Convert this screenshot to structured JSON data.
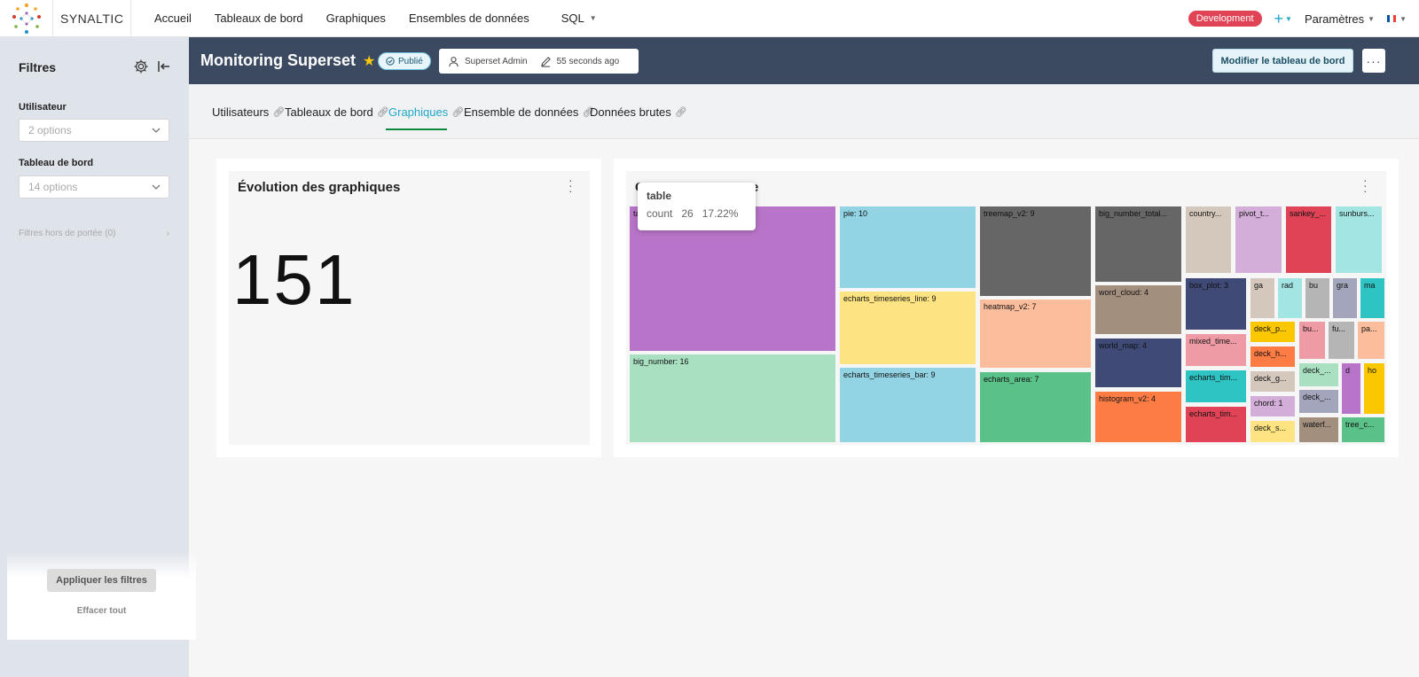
{
  "nav": {
    "brand": "SYNALTIC",
    "items": [
      "Accueil",
      "Tableaux de bord",
      "Graphiques",
      "Ensembles de données"
    ],
    "sql": "SQL",
    "env_badge": "Development",
    "plus": "+",
    "settings": "Paramètres"
  },
  "sidebar": {
    "title": "Filtres",
    "filters": [
      {
        "label": "Utilisateur",
        "placeholder": "2 options"
      },
      {
        "label": "Tableau de bord",
        "placeholder": "14 options"
      }
    ],
    "out_of_scope": "Filtres hors de portée (0)",
    "apply": "Appliquer les filtres",
    "clear": "Effacer tout"
  },
  "dashboard": {
    "title": "Monitoring Superset",
    "status": "Publié",
    "owner": "Superset Admin",
    "modified": "55 seconds ago",
    "edit_label": "Modifier le tableau de bord",
    "more": "···"
  },
  "tabs": [
    {
      "label": "Utilisateurs",
      "active": false
    },
    {
      "label": "Tableaux de bord",
      "active": false
    },
    {
      "label": "Graphiques",
      "active": true
    },
    {
      "label": "Ensemble de données",
      "active": false
    },
    {
      "label": "Données brutes",
      "active": false
    }
  ],
  "big_number_chart": {
    "title": "Évolution des graphiques",
    "value": "151"
  },
  "treemap_chart": {
    "title_visible": "C",
    "title_visible_end": "e",
    "tooltip": {
      "name": "table",
      "metric": "count",
      "value": "26",
      "percent": "17.22%"
    },
    "labels": {
      "table": "ta",
      "big_number": "big_number: 16",
      "pie": "pie: 10",
      "line": "echarts_timeseries_line: 9",
      "bar": "echarts_timeseries_bar: 9",
      "treemap": "treemap_v2: 9",
      "heatmap": "heatmap_v2: 7",
      "area": "echarts_area: 7",
      "bnt": "big_number_total...",
      "wordcloud": "word_cloud: 4",
      "worldmap": "world_map: 4",
      "histogram": "histogram_v2: 4",
      "country": "country...",
      "pivot": "pivot_t...",
      "sankey": "sankey_...",
      "sunburst": "sunburs...",
      "boxplot": "box_plot: 3",
      "mixed": "mixed_time...",
      "ectim1": "echarts_tim...",
      "ectim2": "echarts_tim...",
      "ga": "ga",
      "rad": "rad",
      "bu": "bu",
      "gra": "gra",
      "ma": "ma",
      "deckp": "deck_p...",
      "deckh": "deck_h...",
      "deckg": "deck_g...",
      "chord": "chord: 1",
      "decks": "deck_s...",
      "bu2": "bu...",
      "fu": "fu...",
      "pa": "pa...",
      "deck1": "deck_...",
      "deck2": "deck_...",
      "waterf": "waterf...",
      "d": "d",
      "ho": "ho",
      "treec": "tree_c..."
    },
    "colors": {
      "purple": "#b874c8",
      "green": "#a9e0c2",
      "lightblue": "#92d3e4",
      "yellow": "#fde381",
      "darkgray": "#666666",
      "peach": "#fcbd9c",
      "teal": "#5ac188",
      "brown": "#a38f7d",
      "navy": "#3f4a77",
      "orange": "#fd7c44",
      "beige": "#d4c7bb",
      "lilac": "#d3aed8",
      "red": "#e04355",
      "aqua": "#a3e5e3"
    }
  }
}
